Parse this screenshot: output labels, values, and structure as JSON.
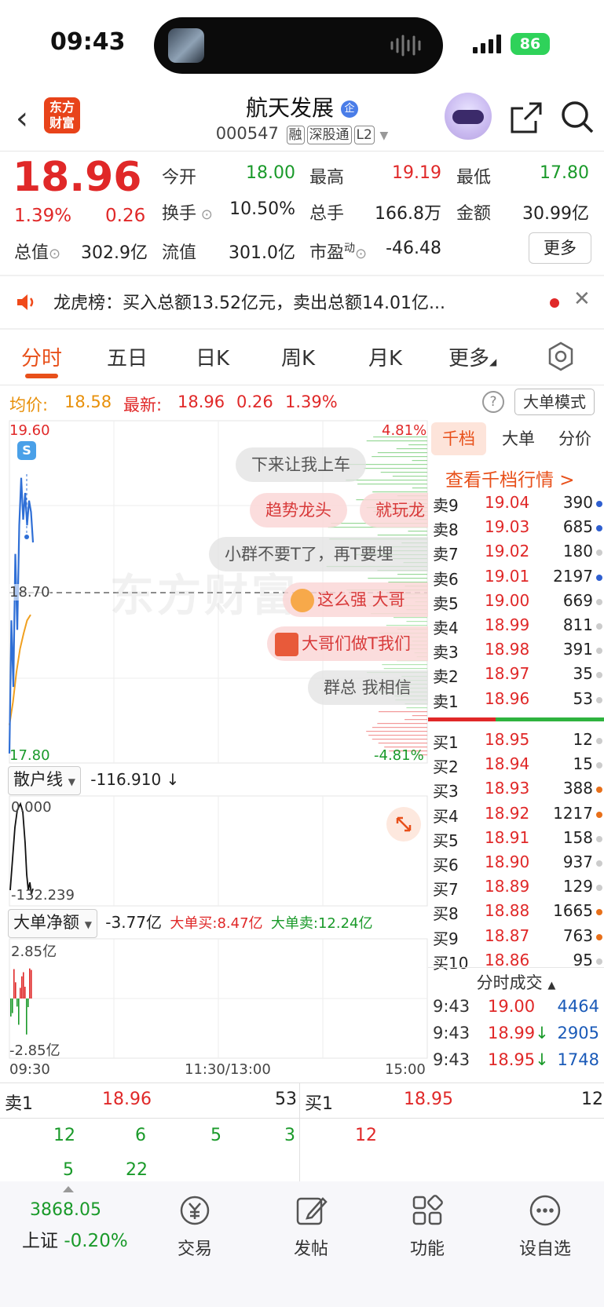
{
  "status_bar": {
    "time": "09:43",
    "battery": "86"
  },
  "header": {
    "logo_text_1": "东方",
    "logo_text_2": "财富",
    "stock_name": "航天发展",
    "stock_badge": "企",
    "stock_code": "000547",
    "tags": [
      "融",
      "深股通",
      "L2"
    ]
  },
  "quote": {
    "price": "18.96",
    "change_pct": "1.39%",
    "change": "0.26",
    "rows": [
      [
        {
          "label": "今开",
          "value": "18.00",
          "color": "green"
        },
        {
          "label": "最高",
          "value": "19.19",
          "color": "red"
        },
        {
          "label": "最低",
          "value": "17.80",
          "color": "green"
        }
      ],
      [
        {
          "label": "换手",
          "value": "10.50%",
          "color": "black"
        },
        {
          "label": "总手",
          "value": "166.8万",
          "color": "black"
        },
        {
          "label": "金额",
          "value": "30.99亿",
          "color": "black"
        }
      ],
      [
        {
          "label": "总值",
          "value": "302.9亿",
          "color": "black"
        },
        {
          "label": "流值",
          "value": "301.0亿",
          "color": "black"
        },
        {
          "label": "市盈",
          "value": "-46.48",
          "color": "black"
        }
      ]
    ],
    "pe_superscript": "动",
    "more_label": "更多"
  },
  "notice": {
    "text": "龙虎榜：买入总额13.52亿元，卖出总额14.01亿..."
  },
  "tabs": [
    "分时",
    "五日",
    "日K",
    "周K",
    "月K",
    "更多"
  ],
  "avg_line": {
    "avg_label": "均价:",
    "avg_value": "18.58",
    "latest_label": "最新:",
    "latest_value": "18.96",
    "latest_change": "0.26",
    "latest_pct": "1.39%",
    "help": "?",
    "mode_label": "大单模式"
  },
  "chart": {
    "y_top": "19.60",
    "y_mid": "18.70",
    "y_bottom": "17.80",
    "pct_top": "4.81%",
    "pct_bottom": "-4.81%",
    "event_marker": "S",
    "x_start": "09:30",
    "x_mid": "11:30/13:00",
    "x_end": "15:00",
    "watermark": "东方财富",
    "price_series": [
      17.85,
      18.55,
      18.2,
      18.9,
      18.5,
      19.05,
      19.3,
      19.08,
      19.22,
      19.05,
      19.18,
      19.12,
      18.96
    ],
    "avg_series": [
      18.0,
      18.12,
      18.28,
      18.4,
      18.48,
      18.55,
      18.58
    ]
  },
  "danmu": [
    "下来让我上车",
    "趋势龙头",
    "就玩龙",
    "小群不要T了，再T要埋",
    "这么强 大哥",
    "大哥们做T我们",
    "群总  我相信"
  ],
  "indicator1": {
    "name": "散户线",
    "value": "-116.910 ↓",
    "top_label": "0.000",
    "bottom_label": "-132.239"
  },
  "indicator2": {
    "name": "大单净额",
    "value": "-3.77亿",
    "buy": "大单买:8.47亿",
    "sell": "大单卖:12.24亿",
    "top_label": "2.85亿",
    "bottom_label": "-2.85亿"
  },
  "order_book": {
    "tabs": [
      "千档",
      "大单",
      "分价"
    ],
    "view_link": "查看千档行情 >",
    "asks": [
      {
        "label": "卖9",
        "price": "19.04",
        "vol": "390",
        "dot": "#2f5fd0"
      },
      {
        "label": "卖8",
        "price": "19.03",
        "vol": "685",
        "dot": "#2f5fd0"
      },
      {
        "label": "卖7",
        "price": "19.02",
        "vol": "180",
        "dot": "#cccccc"
      },
      {
        "label": "卖6",
        "price": "19.01",
        "vol": "2197",
        "dot": "#2f5fd0"
      },
      {
        "label": "卖5",
        "price": "19.00",
        "vol": "669",
        "dot": "#cccccc"
      },
      {
        "label": "卖4",
        "price": "18.99",
        "vol": "811",
        "dot": "#cccccc"
      },
      {
        "label": "卖3",
        "price": "18.98",
        "vol": "391",
        "dot": "#cccccc"
      },
      {
        "label": "卖2",
        "price": "18.97",
        "vol": "35",
        "dot": "#cccccc"
      },
      {
        "label": "卖1",
        "price": "18.96",
        "vol": "53",
        "dot": "#cccccc"
      }
    ],
    "bids": [
      {
        "label": "买1",
        "price": "18.95",
        "vol": "12",
        "dot": "#cccccc"
      },
      {
        "label": "买2",
        "price": "18.94",
        "vol": "15",
        "dot": "#cccccc"
      },
      {
        "label": "买3",
        "price": "18.93",
        "vol": "388",
        "dot": "#e8701a"
      },
      {
        "label": "买4",
        "price": "18.92",
        "vol": "1217",
        "dot": "#e8701a"
      },
      {
        "label": "买5",
        "price": "18.91",
        "vol": "158",
        "dot": "#cccccc"
      },
      {
        "label": "买6",
        "price": "18.90",
        "vol": "937",
        "dot": "#cccccc"
      },
      {
        "label": "买7",
        "price": "18.89",
        "vol": "129",
        "dot": "#cccccc"
      },
      {
        "label": "买8",
        "price": "18.88",
        "vol": "1665",
        "dot": "#e8701a"
      },
      {
        "label": "买9",
        "price": "18.87",
        "vol": "763",
        "dot": "#e8701a"
      },
      {
        "label": "买10",
        "price": "18.86",
        "vol": "95",
        "dot": "#cccccc"
      }
    ],
    "trades_title": "分时成交",
    "trades": [
      {
        "time": "9:43",
        "price": "19.00",
        "vol": "4464",
        "arrow": ""
      },
      {
        "time": "9:43",
        "price": "18.99",
        "vol": "2905",
        "arrow": "↓"
      },
      {
        "time": "9:43",
        "price": "18.95",
        "vol": "1748",
        "arrow": "↓"
      }
    ]
  },
  "bottom_queue": {
    "ask_label": "卖1",
    "ask_price": "18.96",
    "ask_vol": "53",
    "bid_label": "买1",
    "bid_price": "18.95",
    "bid_vol": "12",
    "ask_queue": [
      "12",
      "6",
      "5",
      "3",
      "5",
      "22"
    ],
    "bid_queue": [
      "12"
    ]
  },
  "nav": {
    "index_value": "3868.05",
    "index_name": "上证",
    "index_change": "-0.20%",
    "items": [
      "交易",
      "发帖",
      "功能",
      "设自选"
    ]
  },
  "colors": {
    "up": "#e02828",
    "down": "#1a9a2a",
    "accent": "#e8501a",
    "price_line": "#2f6fd6",
    "avg_line": "#f0a020"
  }
}
